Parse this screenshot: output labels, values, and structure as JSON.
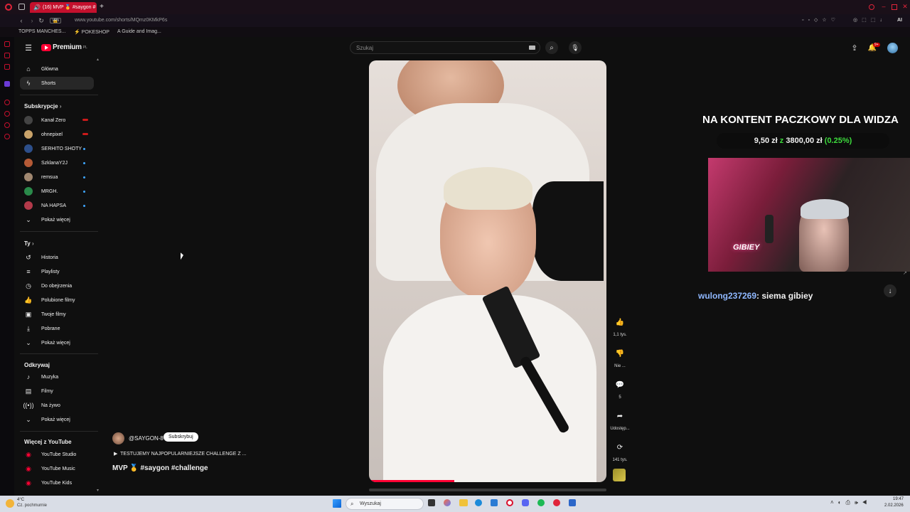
{
  "browser": {
    "tab_title": "(16) MVP 🥇 #saygon #",
    "url": "www.youtube.com/shorts/MQmz0KMkP6s",
    "vpn_badge": "VPN",
    "bookmarks": [
      "TOPPS MANCHES...",
      "POKESHOP",
      "A Guide and Imag..."
    ],
    "ai_label": "AI"
  },
  "header": {
    "logo": "Premium",
    "region": "PL",
    "search_placeholder": "Szukaj",
    "notif_count": "9+"
  },
  "sidebar": {
    "main": [
      {
        "label": "Główna",
        "icon": "home-icon"
      },
      {
        "label": "Shorts",
        "icon": "shorts-icon"
      }
    ],
    "subs_title": "Subskrypcje",
    "subs": [
      {
        "label": "Kanał Zero",
        "color": "#444",
        "badge": "live"
      },
      {
        "label": "ohnepixel",
        "color": "#c9a36a",
        "badge": "live"
      },
      {
        "label": "SERHITO SHOTY",
        "color": "#2d4f8a",
        "badge": "dot"
      },
      {
        "label": "SzklanaY2J",
        "color": "#b55a36",
        "badge": "dot"
      },
      {
        "label": "remsua",
        "color": "#a08770",
        "badge": "dot"
      },
      {
        "label": "MRGH.",
        "color": "#2a8a4a",
        "badge": "dot"
      },
      {
        "label": "NA HAPSA",
        "color": "#b33a4a",
        "badge": "dot"
      }
    ],
    "show_more": "Pokaż więcej",
    "you_title": "Ty",
    "you": [
      {
        "label": "Historia",
        "icon": "history-icon"
      },
      {
        "label": "Playlisty",
        "icon": "playlists-icon"
      },
      {
        "label": "Do obejrzenia",
        "icon": "watch-later-icon"
      },
      {
        "label": "Polubione filmy",
        "icon": "liked-icon"
      },
      {
        "label": "Twoje filmy",
        "icon": "your-videos-icon"
      },
      {
        "label": "Pobrane",
        "icon": "downloads-icon"
      },
      {
        "label": "Pokaż więcej",
        "icon": "chevron-down-icon"
      }
    ],
    "explore_title": "Odkrywaj",
    "explore": [
      {
        "label": "Muzyka",
        "icon": "music-icon"
      },
      {
        "label": "Filmy",
        "icon": "films-icon"
      },
      {
        "label": "Na żywo",
        "icon": "live-icon"
      },
      {
        "label": "Pokaż więcej",
        "icon": "chevron-down-icon"
      }
    ],
    "more_title": "Więcej z YouTube",
    "more": [
      {
        "label": "YouTube Studio"
      },
      {
        "label": "YouTube Music"
      },
      {
        "label": "YouTube Kids"
      }
    ]
  },
  "short": {
    "channel": "@SAYGON-8",
    "subscribe": "Subskrybuj",
    "description": "TESTUJEMY NAJPOPULARNIEJSZE CHALLENGE Z ...",
    "title": "MVP 🥇 #saygon #challenge",
    "likes": "1,1 tys.",
    "dislike": "Nie ...",
    "comments": "5",
    "share": "Udostęp...",
    "remix": "141 tys."
  },
  "overlay": {
    "title": "NA KONTENT PACZKOWY DLA WIDZA",
    "donation_current": "9,50 zł",
    "donation_sep": "z",
    "donation_goal": "3800,00 zł",
    "donation_pct": "(0.25%)",
    "webcam_sign": "GIBIEY",
    "chat_user": "wulong237269",
    "chat_sep": ":",
    "chat_msg": "siema gibiey"
  },
  "taskbar": {
    "weather_temp": "4°C",
    "weather_desc": "Cz. pochmurnie",
    "search": "Wyszukaj",
    "time": "19:47",
    "date": "2.02.2026"
  },
  "colors": {
    "yt_red": "#ff0033",
    "accent_green": "#3ddc3d",
    "chat_user": "#8fb8ff"
  }
}
